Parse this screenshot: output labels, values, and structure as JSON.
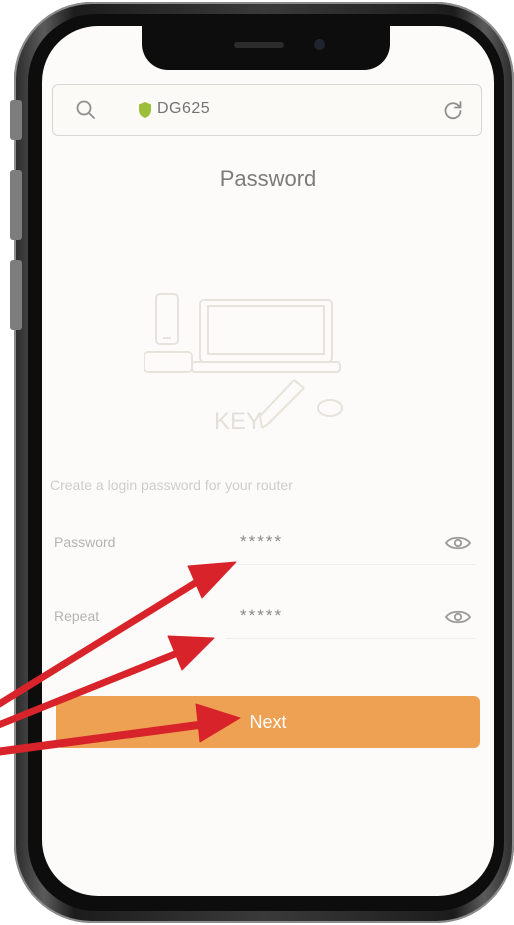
{
  "app": {
    "ssid": "DG625",
    "title": "Password"
  },
  "illustration": {
    "label": "KEY"
  },
  "form": {
    "instruction": "Create a login password for your router",
    "fields": [
      {
        "label": "Password",
        "value": "*****"
      },
      {
        "label": "Repeat",
        "value": "*****"
      }
    ]
  },
  "actions": {
    "next_label": "Next"
  },
  "colors": {
    "accent": "#eea152",
    "annotation_arrow": "#d8232a",
    "ssid_shield": "#9bbf3a"
  }
}
